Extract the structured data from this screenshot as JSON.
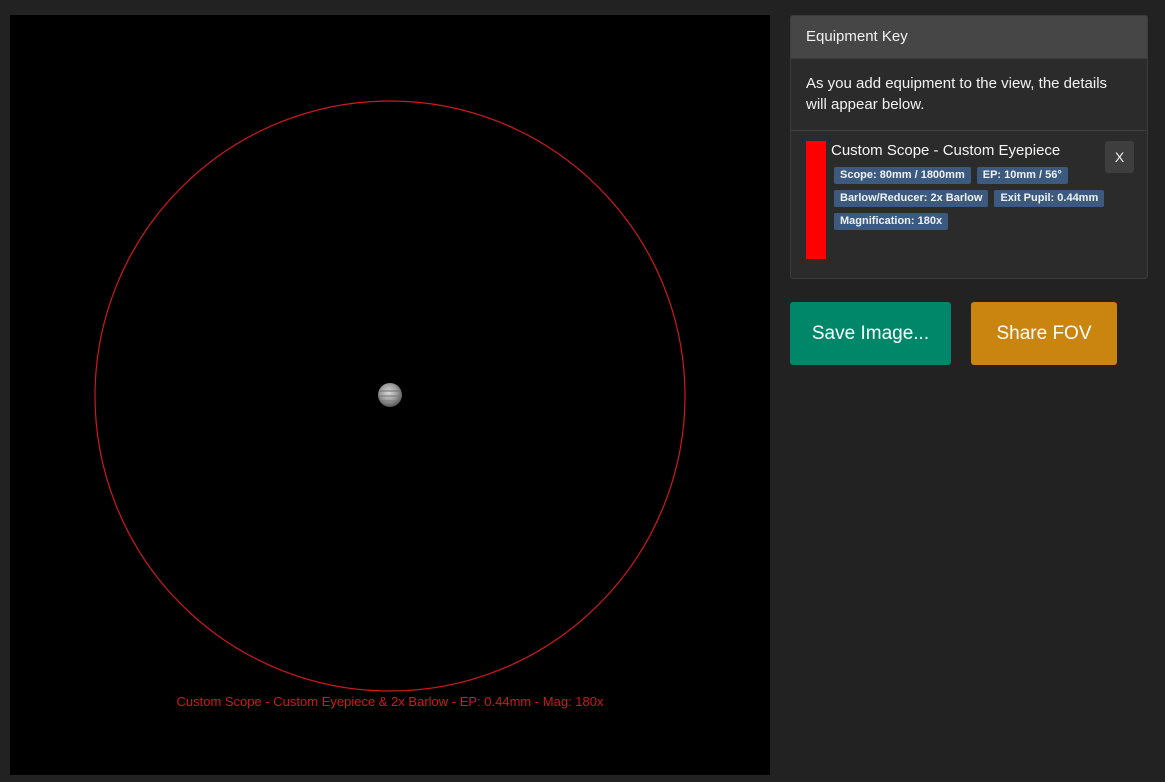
{
  "fov": {
    "caption": "Custom Scope - Custom Eyepiece & 2x Barlow - EP: 0.44mm - Mag: 180x",
    "circle_color": "#d0191b",
    "background_color": "#000000",
    "object_icon": "planet-icon"
  },
  "equipment_key": {
    "title": "Equipment Key",
    "note": "As you add equipment to the view, the details will appear below.",
    "entries": [
      {
        "color": "#ff0000",
        "title": "Custom Scope - Custom Eyepiece",
        "close_label": "X",
        "badges": {
          "scope": "Scope: 80mm / 1800mm",
          "ep": "EP: 10mm / 56°",
          "barlow": "Barlow/Reducer: 2x Barlow",
          "exit_pupil": "Exit Pupil: 0.44mm",
          "magnification": "Magnification: 180x"
        }
      }
    ]
  },
  "actions": {
    "save_label": "Save Image...",
    "save_color": "#00876a",
    "share_label": "Share FOV",
    "share_color": "#c98510"
  }
}
